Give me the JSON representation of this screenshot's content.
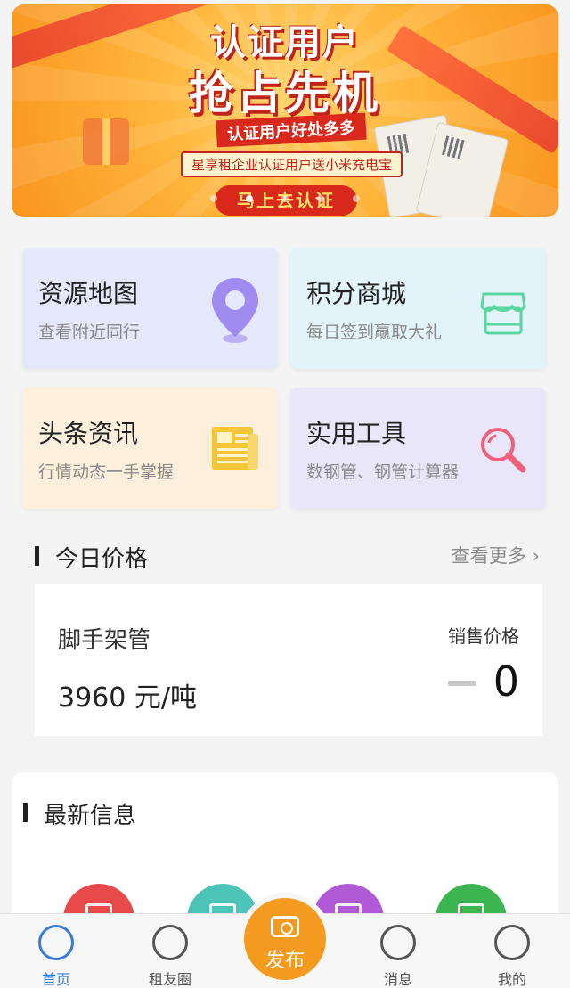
{
  "banner": {
    "title_line1": "认证用户",
    "title_line2": "抢占先机",
    "subtitle": "认证用户好处多多",
    "description": "星享租企业认证用户送小米充电宝",
    "button": "马上去认证",
    "dots": [
      1,
      2,
      3,
      4,
      5
    ],
    "colors": {
      "bg": "#f9951f",
      "accent": "#d9281c"
    }
  },
  "tiles": [
    {
      "title": "资源地图",
      "subtitle": "查看附近同行",
      "icon": "map-pin-icon",
      "color": "#a08cf0"
    },
    {
      "title": "积分商城",
      "subtitle": "每日签到赢取大礼",
      "icon": "store-icon",
      "color": "#5bd6a0"
    },
    {
      "title": "头条资讯",
      "subtitle": "行情动态一手掌握",
      "icon": "newspaper-icon",
      "color": "#f5c53a"
    },
    {
      "title": "实用工具",
      "subtitle": "数钢管、钢管计算器",
      "icon": "magnifier-icon",
      "color": "#f0607a"
    }
  ],
  "price_section": {
    "title": "今日价格",
    "more": "查看更多 ›",
    "item_name": "脚手架管",
    "item_price": "3960 元/吨",
    "label": "销售价格",
    "value": "0"
  },
  "latest": {
    "title": "最新信息",
    "icons": [
      {
        "name": "red-icon",
        "color": "#e84a4a"
      },
      {
        "name": "teal-icon",
        "color": "#4dc4b8"
      },
      {
        "name": "purple-icon",
        "color": "#b05ad8"
      },
      {
        "name": "green-icon",
        "color": "#3ab550"
      }
    ]
  },
  "tabbar": {
    "home": "首页",
    "circle": "租友圈",
    "publish": "发布",
    "messages": "消息",
    "mine": "我的"
  }
}
